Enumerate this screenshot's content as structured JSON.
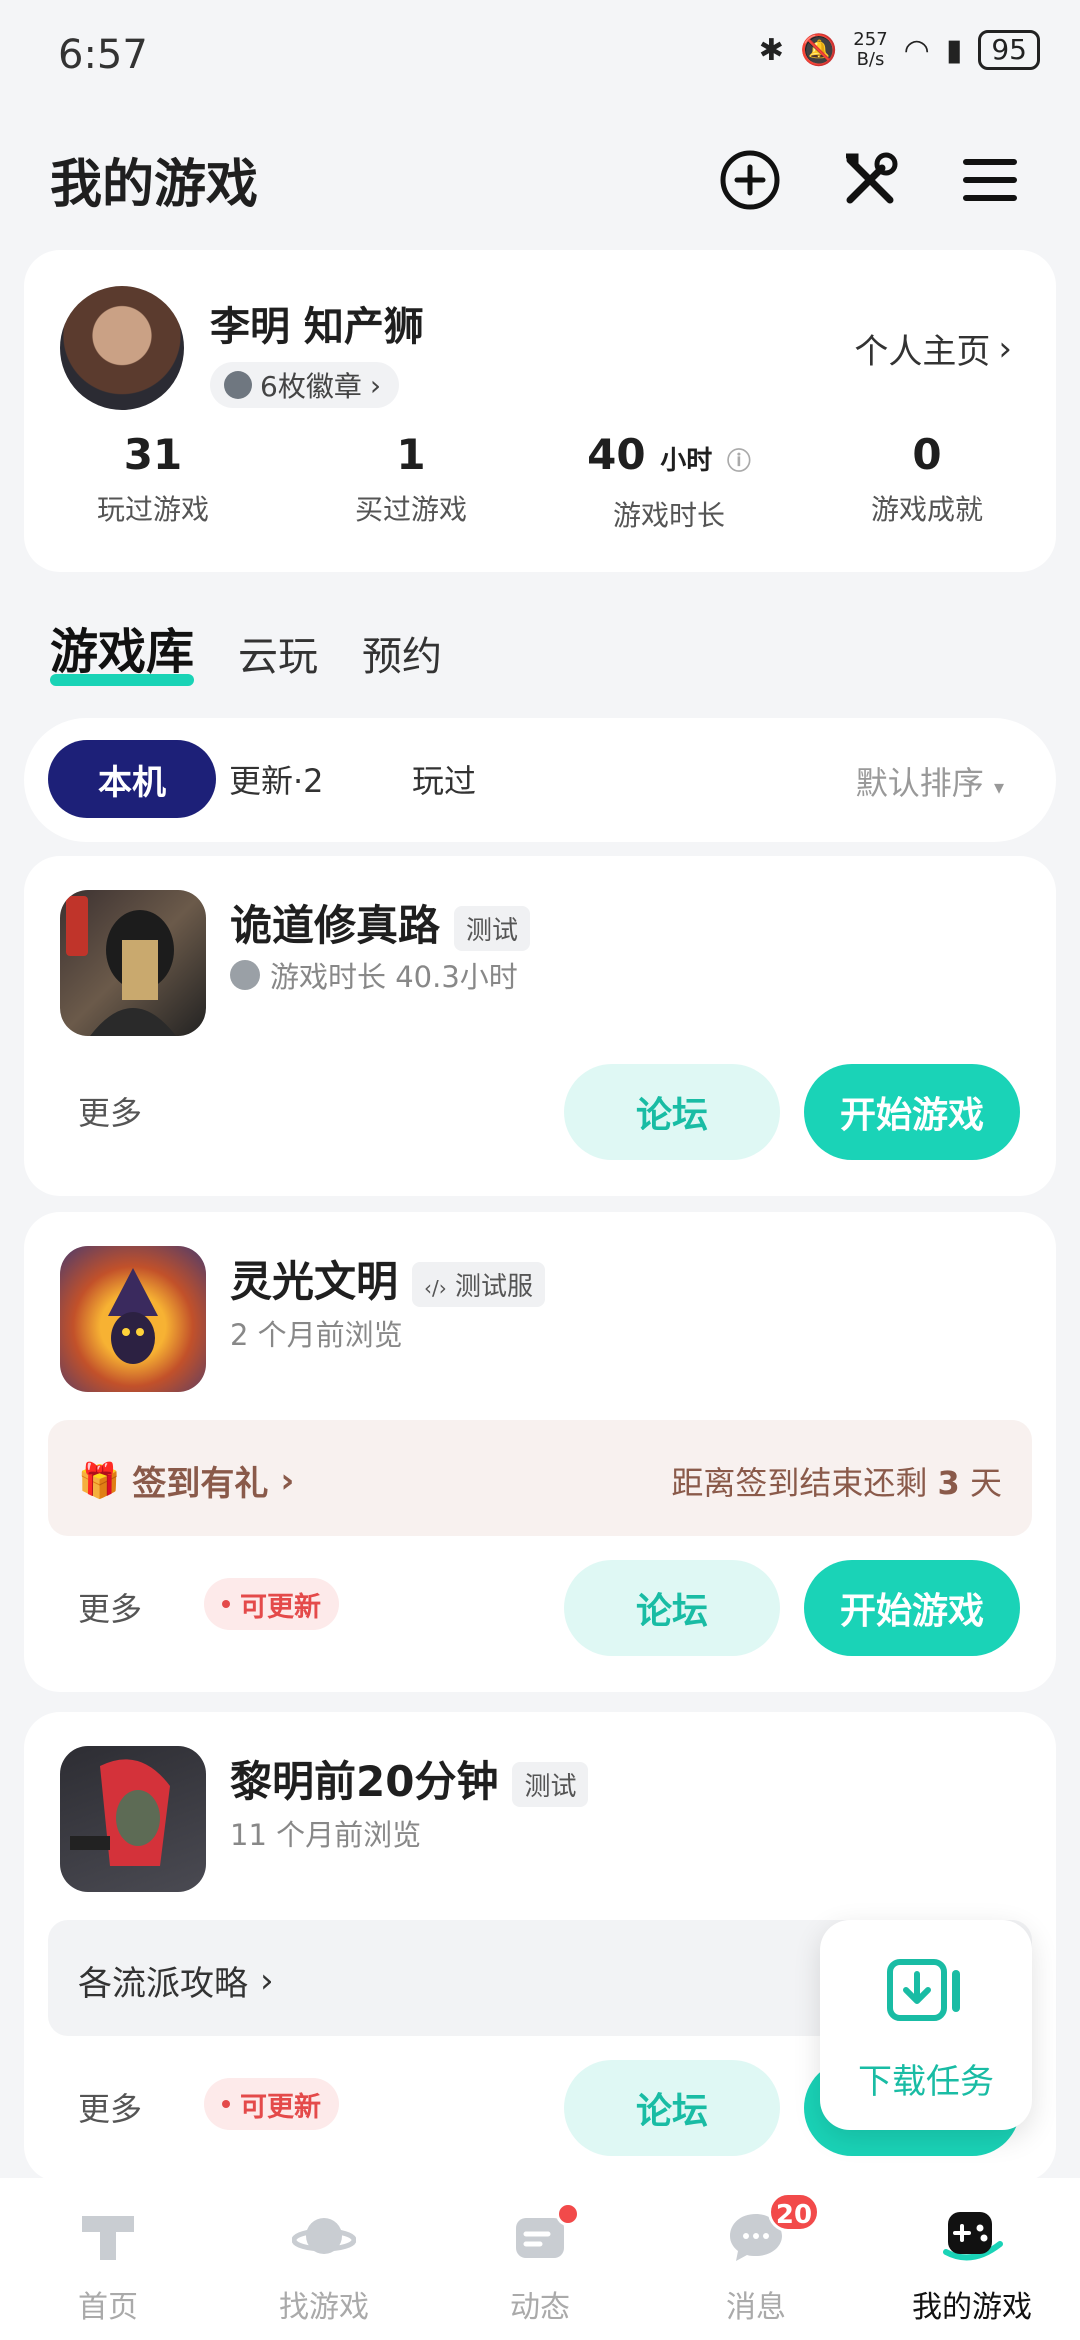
{
  "status_bar": {
    "time": "6:57",
    "net_speed_value": "257",
    "net_speed_unit": "B/s",
    "battery": "95"
  },
  "header": {
    "title": "我的游戏",
    "icons": [
      "add-circle-icon",
      "tools-icon",
      "menu-icon"
    ]
  },
  "profile": {
    "name": "李明  知产狮",
    "badges": "6枚徽章",
    "home_link": "个人主页",
    "stats": [
      {
        "value": "31",
        "unit": "",
        "label": "玩过游戏"
      },
      {
        "value": "1",
        "unit": "",
        "label": "买过游戏"
      },
      {
        "value": "40",
        "unit": "小时",
        "label": "游戏时长"
      },
      {
        "value": "0",
        "unit": "",
        "label": "游戏成就"
      }
    ]
  },
  "library_tabs": [
    "游戏库",
    "云玩",
    "预约"
  ],
  "filters": {
    "items": [
      "本机",
      "更新·2",
      "玩过"
    ],
    "sort": "默认排序"
  },
  "games": [
    {
      "title": "诡道修真路",
      "tag": "测试",
      "subtitle": "游戏时长 40.3小时",
      "more": "更多",
      "forum": "论坛",
      "start": "开始游戏"
    },
    {
      "title": "灵光文明",
      "tag": "测试服",
      "subtitle": "2 个月前浏览",
      "strip_left": "签到有礼",
      "strip_right_prefix": "距离签到结束还剩 ",
      "strip_right_num": "3",
      "strip_right_suffix": " 天",
      "more": "更多",
      "update": "可更新",
      "forum": "论坛",
      "start": "开始游戏"
    },
    {
      "title": "黎明前20分钟",
      "tag": "测试",
      "subtitle": "11 个月前浏览",
      "strip_left": "各流派攻略",
      "more": "更多",
      "update": "可更新",
      "forum": "论坛"
    }
  ],
  "float_download": {
    "label": "下载任务"
  },
  "bottom_nav": [
    {
      "label": "首页"
    },
    {
      "label": "找游戏"
    },
    {
      "label": "动态"
    },
    {
      "label": "消息",
      "badge": "20"
    },
    {
      "label": "我的游戏"
    }
  ],
  "colors": {
    "accent": "#1ad3b7",
    "navy": "#1d2078",
    "alert": "#f24a4a"
  }
}
